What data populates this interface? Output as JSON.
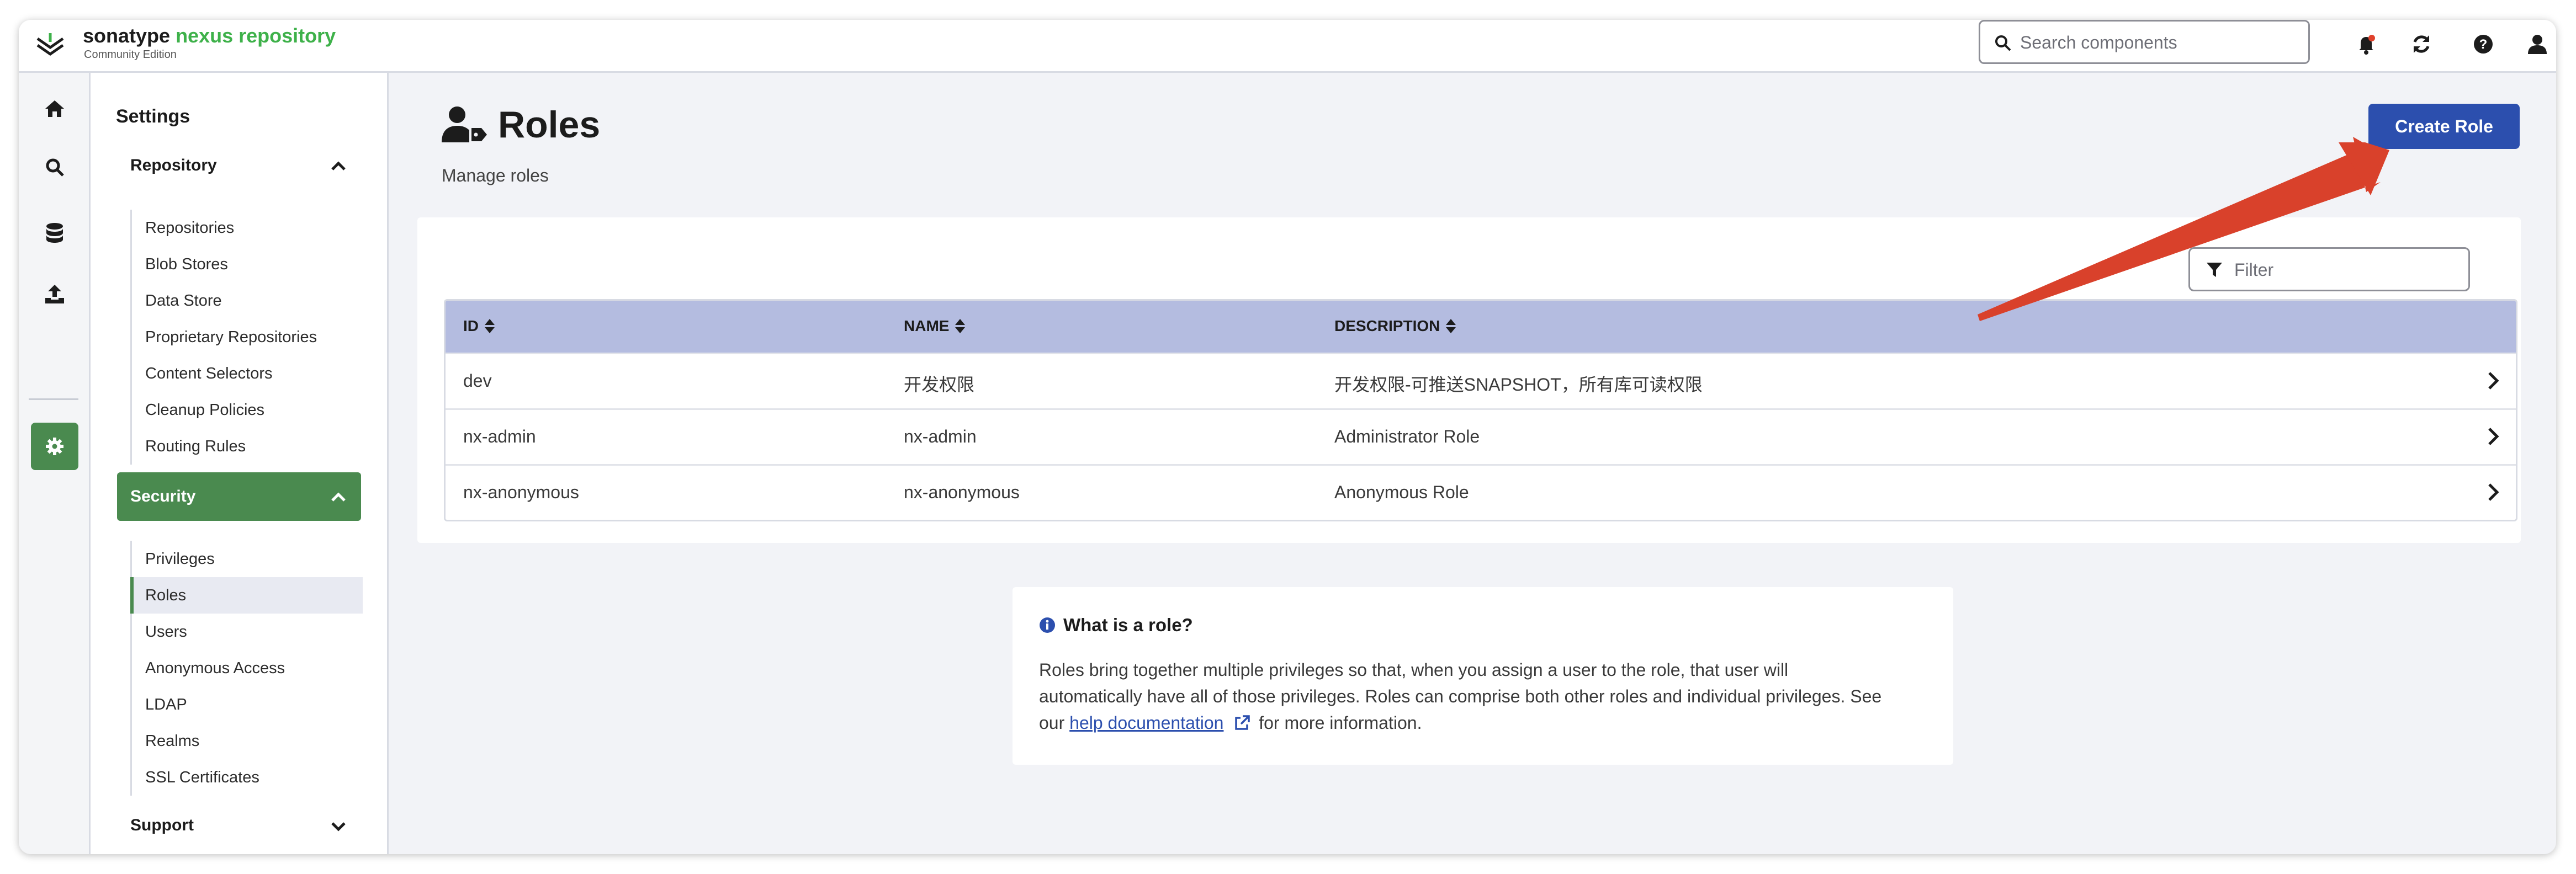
{
  "header": {
    "brand_name": "sonatype",
    "brand_product": "nexus repository",
    "brand_edition": "Community Edition",
    "search_placeholder": "Search components"
  },
  "rail": {
    "items": [
      {
        "name": "home-icon"
      },
      {
        "name": "search-icon"
      },
      {
        "name": "database-icon"
      },
      {
        "name": "upload-icon"
      },
      {
        "name": "gear-icon"
      }
    ]
  },
  "sidebar": {
    "title": "Settings",
    "repository": {
      "label": "Repository",
      "items": [
        "Repositories",
        "Blob Stores",
        "Data Store",
        "Proprietary Repositories",
        "Content Selectors",
        "Cleanup Policies",
        "Routing Rules"
      ]
    },
    "security": {
      "label": "Security",
      "items": [
        "Privileges",
        "Roles",
        "Users",
        "Anonymous Access",
        "LDAP",
        "Realms",
        "SSL Certificates"
      ]
    },
    "support": {
      "label": "Support"
    }
  },
  "page": {
    "title": "Roles",
    "subtitle": "Manage roles",
    "create_button": "Create Role",
    "filter_placeholder": "Filter"
  },
  "table": {
    "columns": [
      "ID",
      "NAME",
      "DESCRIPTION"
    ],
    "rows": [
      {
        "id": "dev",
        "name": "开发权限",
        "description": "开发权限-可推送SNAPSHOT，所有库可读权限"
      },
      {
        "id": "nx-admin",
        "name": "nx-admin",
        "description": "Administrator Role"
      },
      {
        "id": "nx-anonymous",
        "name": "nx-anonymous",
        "description": "Anonymous Role"
      }
    ]
  },
  "info": {
    "title": "What is a role?",
    "line1": "Roles bring together multiple privileges so that, when you assign a user to the role, that user will",
    "line2": "automatically have all of those privileges. Roles can comprise both other roles and individual privileges. See",
    "line3_prefix": "our",
    "link": "help documentation",
    "line3_suffix": "for more information."
  },
  "colors": {
    "accent": "#2c4fae",
    "active_green": "#4a8a4f",
    "table_header": "#b4bce0",
    "annotation_arrow": "#d9412b"
  }
}
